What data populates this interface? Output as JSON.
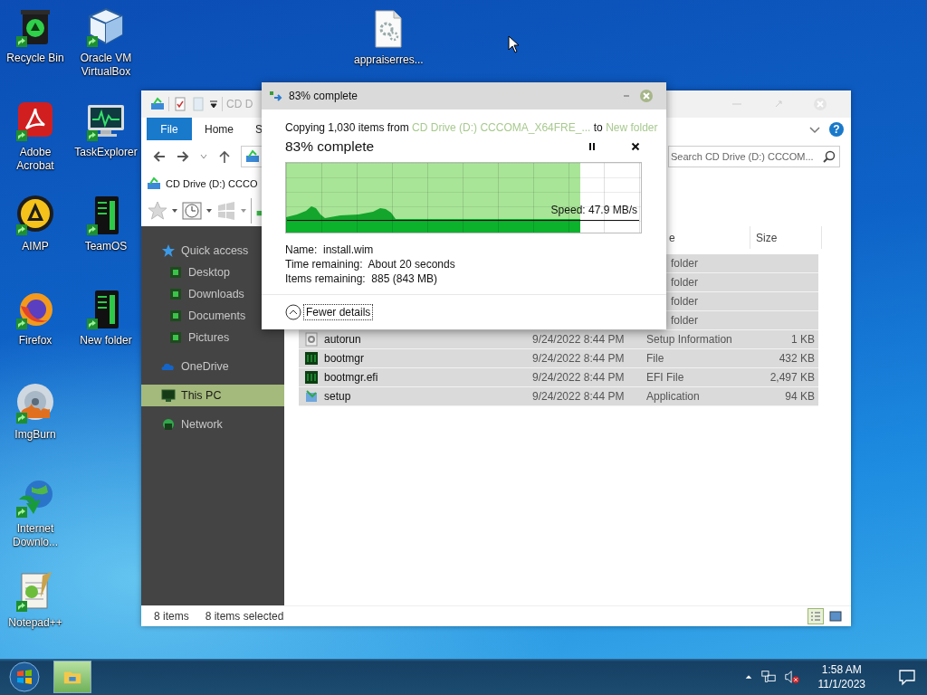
{
  "desktop": {
    "icons": [
      {
        "kind": "recycle",
        "label": "Recycle Bin"
      },
      {
        "kind": "pdf",
        "label": "Adobe Acrobat"
      },
      {
        "kind": "player",
        "label": "AIMP"
      },
      {
        "kind": "browser",
        "label": "Firefox"
      },
      {
        "kind": "disc",
        "label": "ImgBurn"
      },
      {
        "kind": "globe",
        "label": "Internet Downlo..."
      },
      {
        "kind": "notepad",
        "label": "Notepad++"
      },
      {
        "kind": "cube",
        "label": "Oracle VM VirtualBox"
      },
      {
        "kind": "monitor",
        "label": "TaskExplorer"
      },
      {
        "kind": "tower",
        "label": "TeamOS"
      },
      {
        "kind": "tower",
        "label": "New folder"
      }
    ],
    "file_icon": {
      "label": "appraiserres..."
    }
  },
  "explorer": {
    "title": "CD D",
    "ribbon_tabs": [
      {
        "kind": "file",
        "label": "File"
      },
      {
        "kind": "tab",
        "label": "Home"
      },
      {
        "kind": "tab",
        "label": "S"
      }
    ],
    "help": "?",
    "search": {
      "placeholder": "Search CD Drive (D:) CCCOM..."
    },
    "location": "CD Drive (D:) CCCO",
    "nav": [
      {
        "kind": "star",
        "label": "Quick access",
        "selected": false,
        "children": [
          {
            "kind": "folder",
            "label": "Desktop",
            "selected": false
          },
          {
            "kind": "folder",
            "label": "Downloads",
            "selected": false
          },
          {
            "kind": "folder",
            "label": "Documents",
            "selected": false
          },
          {
            "kind": "folder",
            "label": "Pictures",
            "selected": false
          }
        ]
      },
      {
        "kind": "cloud",
        "label": "OneDrive",
        "selected": false
      },
      {
        "kind": "pc",
        "label": "This PC",
        "selected": true
      },
      {
        "kind": "network",
        "label": "Network",
        "selected": false
      }
    ],
    "columns": [
      {
        "label": "e"
      },
      {
        "label": "Size"
      }
    ],
    "rows": [
      {
        "type": "folder",
        "selected": true
      },
      {
        "type": "folder",
        "selected": true
      },
      {
        "type": "folder",
        "selected": true
      },
      {
        "type": "folder",
        "selected": true
      },
      {
        "kind": "settings",
        "name": "autorun",
        "date": "9/24/2022 8:44 PM",
        "type": "Setup Information",
        "size": "1 KB",
        "selected": true
      },
      {
        "kind": "system",
        "name": "bootmgr",
        "date": "9/24/2022 8:44 PM",
        "type": "File",
        "size": "432 KB",
        "selected": true
      },
      {
        "kind": "system",
        "name": "bootmgr.efi",
        "date": "9/24/2022 8:44 PM",
        "type": "EFI File",
        "size": "2,497 KB",
        "selected": true
      },
      {
        "kind": "installer",
        "name": "setup",
        "date": "9/24/2022 8:44 PM",
        "type": "Application",
        "size": "94 KB",
        "selected": true
      }
    ],
    "status": {
      "count": "8 items",
      "selection": "8 items selected"
    }
  },
  "copy_dialog": {
    "title": "83% complete",
    "summary_prefix": "Copying 1,030 items from",
    "source": "CD Drive (D:) CCCOMA_X64FRE_...",
    "connector": "to",
    "destination": "New folder",
    "heading": "83% complete",
    "progress": {
      "level": 0.83
    },
    "speed": "Speed: 47.9 MB/s",
    "details": [
      "Name:  install.wim",
      "Time remaining:  About 20 seconds",
      "Items remaining:  885 (843 MB)"
    ],
    "toggle": "Fewer details"
  },
  "taskbar": {
    "apps": [
      {
        "kind": "explorer",
        "selected": true
      }
    ],
    "time": "1:58 AM",
    "date": "11/1/2023"
  }
}
